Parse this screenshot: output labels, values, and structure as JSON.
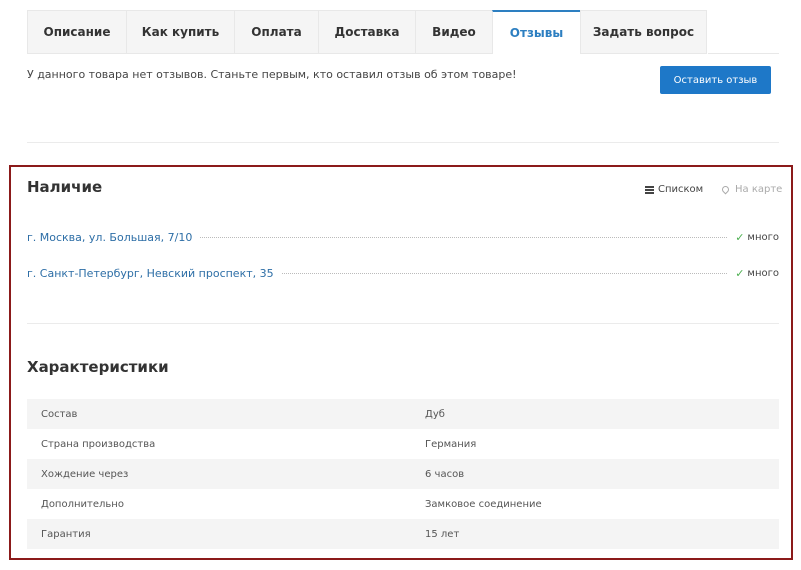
{
  "tabs": [
    {
      "label": "Описание"
    },
    {
      "label": "Как купить"
    },
    {
      "label": "Оплата"
    },
    {
      "label": "Доставка"
    },
    {
      "label": "Видео"
    },
    {
      "label": "Отзывы",
      "active": true
    },
    {
      "label": "Задать вопрос"
    }
  ],
  "reviews": {
    "empty_text": "У данного товара нет отзывов. Станьте первым, кто оставил отзыв об этом товаре!",
    "button_label": "Оставить отзыв"
  },
  "availability": {
    "title": "Наличие",
    "view_list_label": "Списком",
    "view_map_label": "На карте",
    "stores": [
      {
        "address": "г. Москва, ул. Большая, 7/10",
        "stock": "много"
      },
      {
        "address": "г. Санкт-Петербург, Невский проспект, 35",
        "stock": "много"
      }
    ]
  },
  "specs": {
    "title": "Характеристики",
    "rows": [
      {
        "name": "Состав",
        "value": "Дуб"
      },
      {
        "name": "Страна производства",
        "value": "Германия"
      },
      {
        "name": "Хождение через",
        "value": "6 часов"
      },
      {
        "name": "Дополнительно",
        "value": "Замковое соединение"
      },
      {
        "name": "Гарантия",
        "value": "15 лет"
      }
    ]
  },
  "colors": {
    "accent": "#2d7fc1",
    "button": "#1e78c8",
    "frame": "#8b1a1a",
    "check": "#4caf50"
  }
}
